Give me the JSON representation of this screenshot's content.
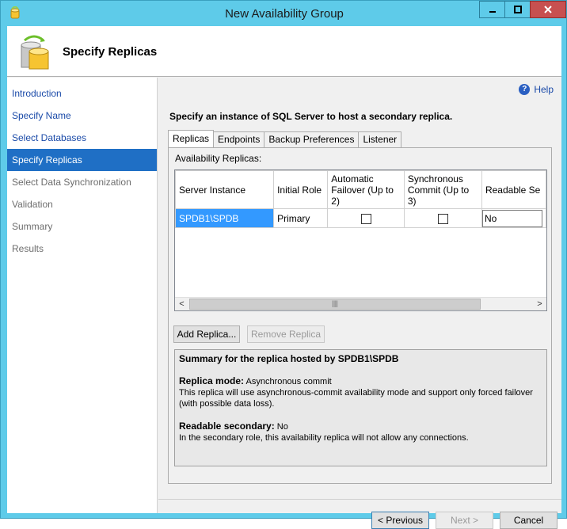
{
  "window": {
    "title": "New Availability Group"
  },
  "header": {
    "title": "Specify Replicas"
  },
  "nav": {
    "items": [
      {
        "label": "Introduction",
        "state": "link"
      },
      {
        "label": "Specify Name",
        "state": "link"
      },
      {
        "label": "Select Databases",
        "state": "link"
      },
      {
        "label": "Specify Replicas",
        "state": "active"
      },
      {
        "label": "Select Data Synchronization",
        "state": "disabled"
      },
      {
        "label": "Validation",
        "state": "disabled"
      },
      {
        "label": "Summary",
        "state": "disabled"
      },
      {
        "label": "Results",
        "state": "disabled"
      }
    ]
  },
  "help": {
    "label": "Help"
  },
  "main": {
    "instruction": "Specify an instance of SQL Server to host a secondary replica.",
    "tabs": [
      "Replicas",
      "Endpoints",
      "Backup Preferences",
      "Listener"
    ],
    "availability_label": "Availability Replicas:",
    "columns": [
      "Server Instance",
      "Initial Role",
      "Automatic Failover (Up to 2)",
      "Synchronous Commit (Up to 3)",
      "Readable Se"
    ],
    "rows": [
      {
        "server": "SPDB1\\SPDB",
        "role": "Primary",
        "auto_failover": false,
        "sync_commit": false,
        "readable": "No"
      }
    ],
    "add_replica": "Add Replica...",
    "remove_replica": "Remove Replica",
    "summary": {
      "heading": "Summary for the replica hosted by SPDB1\\SPDB",
      "mode_key": "Replica mode:",
      "mode_value": "Asynchronous commit",
      "mode_desc": "This replica will use asynchronous-commit availability mode and support only forced failover (with possible data loss).",
      "readable_key": "Readable secondary:",
      "readable_value": "No",
      "readable_desc": "In the secondary role, this availability replica will not allow any connections."
    }
  },
  "footer": {
    "previous": "< Previous",
    "next": "Next >",
    "cancel": "Cancel"
  },
  "colors": {
    "accent": "#1f6fc5",
    "titlebar": "#5ecbe9",
    "close": "#c75050",
    "selection": "#3399ff"
  }
}
